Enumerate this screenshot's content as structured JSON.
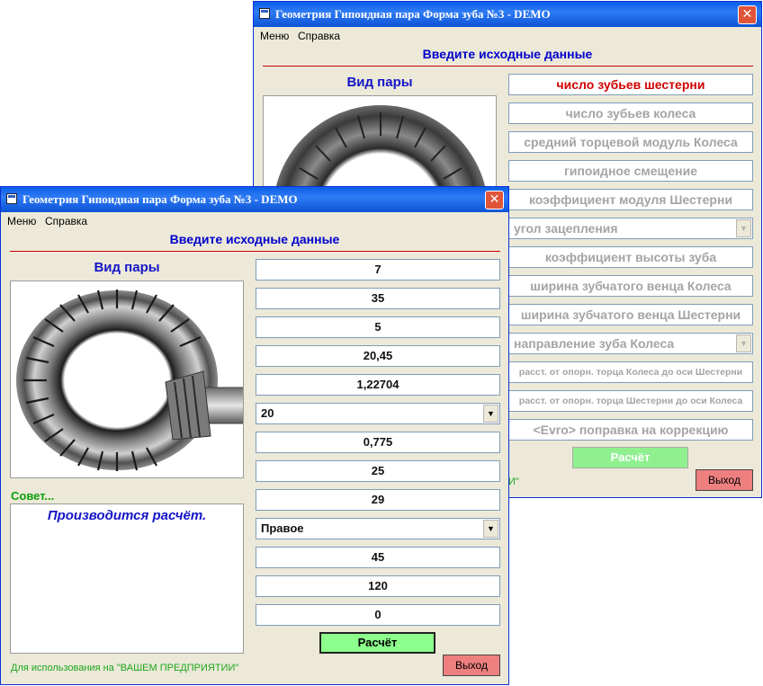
{
  "back_window": {
    "title": "Геометрия Гипоидная пара Форма зуба №3 - DEMO",
    "close_glyph": "✕",
    "menu": [
      "Меню",
      "Справка"
    ],
    "heading": "Введите исходные данные",
    "vid_pary": "Вид пары",
    "labels": [
      "число зубьев шестерни",
      "число зубьев колеса",
      "средний торцевой модуль Колеса",
      "гипоидное смещение",
      "коэффициент модуля Шестерни",
      "угол зацепления",
      "коэффициент высоты зуба",
      "ширина зубчатого венца Колеса",
      "ширина зубчатого венца Шестерни",
      "направление зуба Колеса",
      "расст. от опорн. торца Колеса до оси Шестерни",
      "расст. от опорн. торца Шестерни до оси Колеса",
      "<Evro> поправка на коррекцию"
    ],
    "calc_label": "Расчёт",
    "exit_label": "Выход",
    "footer_fragment": "И\""
  },
  "front_window": {
    "title": "Геометрия Гипоидная пара Форма зуба №3 - DEMO",
    "close_glyph": "✕",
    "menu": [
      "Меню",
      "Справка"
    ],
    "heading": "Введите исходные данные",
    "vid_pary": "Вид пары",
    "values": [
      "7",
      "35",
      "5",
      "20,45",
      "1,22704",
      "20",
      "0,775",
      "25",
      "29",
      "Правое",
      "45",
      "120",
      "0"
    ],
    "sovet_label": "Совет...",
    "sovet_text": "Производится расчёт.",
    "calc_label": "Расчёт",
    "exit_label": "Выход",
    "footer": "Для использования на  \"ВАШЕМ ПРЕДПРИЯТИИ\""
  },
  "icons": {
    "dropdown": "▼"
  },
  "colors": {
    "title_bar": "#0a5fe8",
    "heading": "#0000cc",
    "red_line": "#d00000",
    "calc_button": "#8cff8c",
    "exit_button": "#ee7f7f",
    "active_label": "#d00000"
  }
}
